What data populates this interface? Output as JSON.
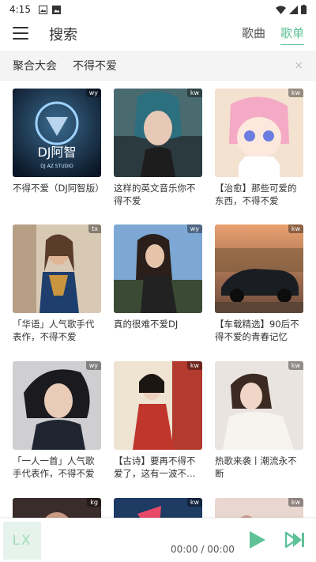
{
  "status_bar": {
    "time": "4:15"
  },
  "header": {
    "title": "搜索",
    "tabs": [
      {
        "label": "歌曲",
        "active": false
      },
      {
        "label": "歌单",
        "active": true
      }
    ],
    "accent_color": "#5ec198"
  },
  "subbar": {
    "chips": [
      "聚合大会",
      "不得不爱"
    ],
    "close_label": "×"
  },
  "playlists": [
    {
      "title": "不得不爱（DJ阿智版）",
      "source": "wy",
      "cover_text": "DJ阿智",
      "cover_subtext": "DJ AZ STUDIO"
    },
    {
      "title": "这样的英文音乐你不得不爱",
      "source": "kw"
    },
    {
      "title": "【治愈】那些可爱的东西，不得不爱",
      "source": "kw"
    },
    {
      "title": "「华语」人气歌手代表作，不得不爱",
      "source": "tx"
    },
    {
      "title": "真的很难不爱DJ",
      "source": "wy"
    },
    {
      "title": "【车载精选】90后不得不爱的青春记忆",
      "source": "kw"
    },
    {
      "title": "「一人一首」人气歌手代表作，不得不爱",
      "source": "wy"
    },
    {
      "title": "【古诗】要再不得不爱了，这有一波不…",
      "source": "kw"
    },
    {
      "title": "热歌来袭丨潮流永不断",
      "source": "kw"
    },
    {
      "title": "",
      "source": "kg"
    },
    {
      "title": "",
      "source": "kw"
    },
    {
      "title": "",
      "source": "kw"
    }
  ],
  "player": {
    "logo": "LX",
    "time": "00:00 / 00:00",
    "play_icon": "play-icon",
    "next_icon": "next-icon"
  }
}
